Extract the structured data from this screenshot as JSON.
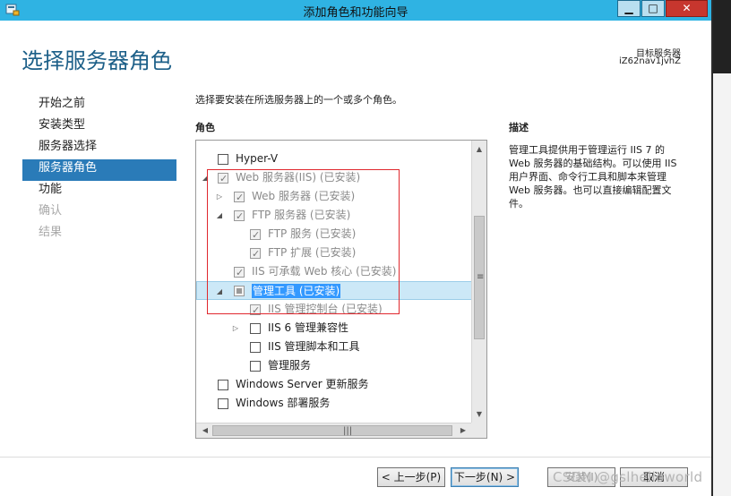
{
  "window": {
    "title": "添加角色和功能向导",
    "min_symbol": "▁",
    "max_symbol": "□",
    "close_symbol": "✕"
  },
  "header": {
    "page_title": "选择服务器角色",
    "target_label": "目标服务器",
    "target_name": "iZ62nav1jvhZ"
  },
  "nav": {
    "items": [
      {
        "label": "开始之前",
        "state": "normal"
      },
      {
        "label": "安装类型",
        "state": "normal"
      },
      {
        "label": "服务器选择",
        "state": "normal"
      },
      {
        "label": "服务器角色",
        "state": "selected"
      },
      {
        "label": "功能",
        "state": "normal"
      },
      {
        "label": "确认",
        "state": "disabled"
      },
      {
        "label": "结果",
        "state": "disabled"
      }
    ]
  },
  "content": {
    "instruction": "选择要安装在所选服务器上的一个或多个角色。",
    "roles_heading": "角色",
    "description_heading": "描述",
    "description_text": "管理工具提供用于管理运行 IIS 7 的 Web 服务器的基础结构。可以使用 IIS 用户界面、命令行工具和脚本来管理 Web 服务器。也可以直接编辑配置文件。"
  },
  "roles": [
    {
      "label": "Hyper-V"
    },
    {
      "label": "Web 服务器(IIS) (已安装)",
      "expander": "◢"
    },
    {
      "label": "Web 服务器 (已安装)",
      "expander": "▷"
    },
    {
      "label": "FTP 服务器 (已安装)",
      "expander": "◢"
    },
    {
      "label": "FTP 服务 (已安装)"
    },
    {
      "label": "FTP 扩展 (已安装)"
    },
    {
      "label": "IIS 可承载 Web 核心 (已安装)"
    },
    {
      "label": "管理工具 (已安装)",
      "expander": "◢"
    },
    {
      "label": "IIS 管理控制台 (已安装)"
    },
    {
      "label": "IIS 6 管理兼容性",
      "expander": "▷"
    },
    {
      "label": "IIS 管理脚本和工具"
    },
    {
      "label": "管理服务"
    },
    {
      "label": "Windows Server 更新服务"
    },
    {
      "label": "Windows 部署服务"
    }
  ],
  "scroll": {
    "up": "▲",
    "down": "▼",
    "left": "◀",
    "right": "▶",
    "vgrip": "≡",
    "hgrip": "|||"
  },
  "buttons": {
    "prev": "< 上一步(P)",
    "next": "下一步(N) >",
    "install": "安装(I)",
    "cancel": "取消"
  },
  "watermark": "CSDN @gslhelloworld",
  "colors": {
    "titlebar": "#2fb3e3",
    "accent": "#2a7bb8",
    "page_title": "#1c5f88",
    "annotation": "#e0282e"
  }
}
